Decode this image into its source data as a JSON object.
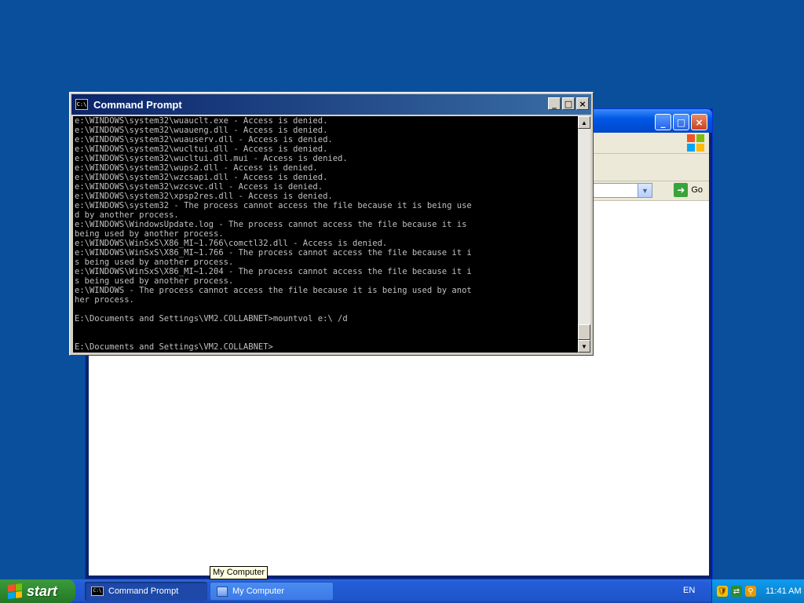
{
  "background_window": {
    "title": "",
    "address": {
      "value": "",
      "go_label": "Go"
    },
    "icons": {
      "logo": "windows-flag-icon"
    }
  },
  "cmd": {
    "title": "Command Prompt",
    "buttons": {
      "minimize": "_",
      "maximize": "□",
      "close": "×"
    },
    "lines": [
      "e:\\WINDOWS\\system32\\wuauclt.exe - Access is denied.",
      "e:\\WINDOWS\\system32\\wuaueng.dll - Access is denied.",
      "e:\\WINDOWS\\system32\\wuauserv.dll - Access is denied.",
      "e:\\WINDOWS\\system32\\wucltui.dll - Access is denied.",
      "e:\\WINDOWS\\system32\\wucltui.dll.mui - Access is denied.",
      "e:\\WINDOWS\\system32\\wups2.dll - Access is denied.",
      "e:\\WINDOWS\\system32\\wzcsapi.dll - Access is denied.",
      "e:\\WINDOWS\\system32\\wzcsvc.dll - Access is denied.",
      "e:\\WINDOWS\\system32\\xpsp2res.dll - Access is denied.",
      "e:\\WINDOWS\\system32 - The process cannot access the file because it is being use",
      "d by another process.",
      "e:\\WINDOWS\\WindowsUpdate.log - The process cannot access the file because it is",
      "being used by another process.",
      "e:\\WINDOWS\\WinSxS\\X86_MI~1.766\\comctl32.dll - Access is denied.",
      "e:\\WINDOWS\\WinSxS\\X86_MI~1.766 - The process cannot access the file because it i",
      "s being used by another process.",
      "e:\\WINDOWS\\WinSxS\\X86_MI~1.204 - The process cannot access the file because it i",
      "s being used by another process.",
      "e:\\WINDOWS - The process cannot access the file because it is being used by anot",
      "her process.",
      "",
      "E:\\Documents and Settings\\VM2.COLLABNET>mountvol e:\\ /d",
      "",
      "",
      "E:\\Documents and Settings\\VM2.COLLABNET>"
    ]
  },
  "tooltip": {
    "text": "My Computer"
  },
  "taskbar": {
    "start_label": "start",
    "tasks": [
      {
        "label": "Command Prompt",
        "icon": "cmd-icon",
        "active": true
      },
      {
        "label": "My Computer",
        "icon": "computer-icon",
        "active": false
      }
    ],
    "language": "EN",
    "clock": "11:41 AM",
    "tray_icons": [
      "security-shield-icon",
      "network-icon",
      "search-icon"
    ]
  }
}
